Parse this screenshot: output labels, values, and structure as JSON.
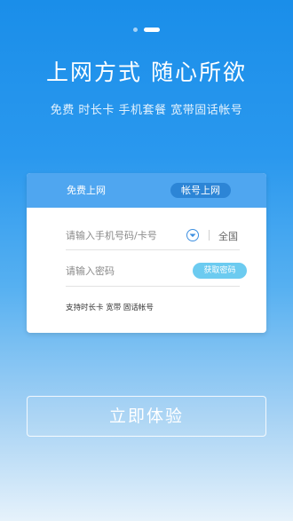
{
  "headline": "上网方式  随心所欲",
  "subline": "免费  时长卡  手机套餐  宽带固话帐号",
  "card": {
    "tab_free": "免费上网",
    "tab_account": "帐号上网",
    "phone_placeholder": "请输入手机号码/卡号",
    "region": "全国",
    "password_placeholder": "请输入密码",
    "get_code": "获取密码",
    "support_text": "支持时长卡 宽带 固话帐号"
  },
  "cta_label": "立即体验",
  "colors": {
    "accent": "#2c85d6",
    "tab_bar": "#4fa6f0",
    "code_button": "#6ccbf0"
  },
  "icons": {
    "dropdown": "chevron-down-icon"
  }
}
